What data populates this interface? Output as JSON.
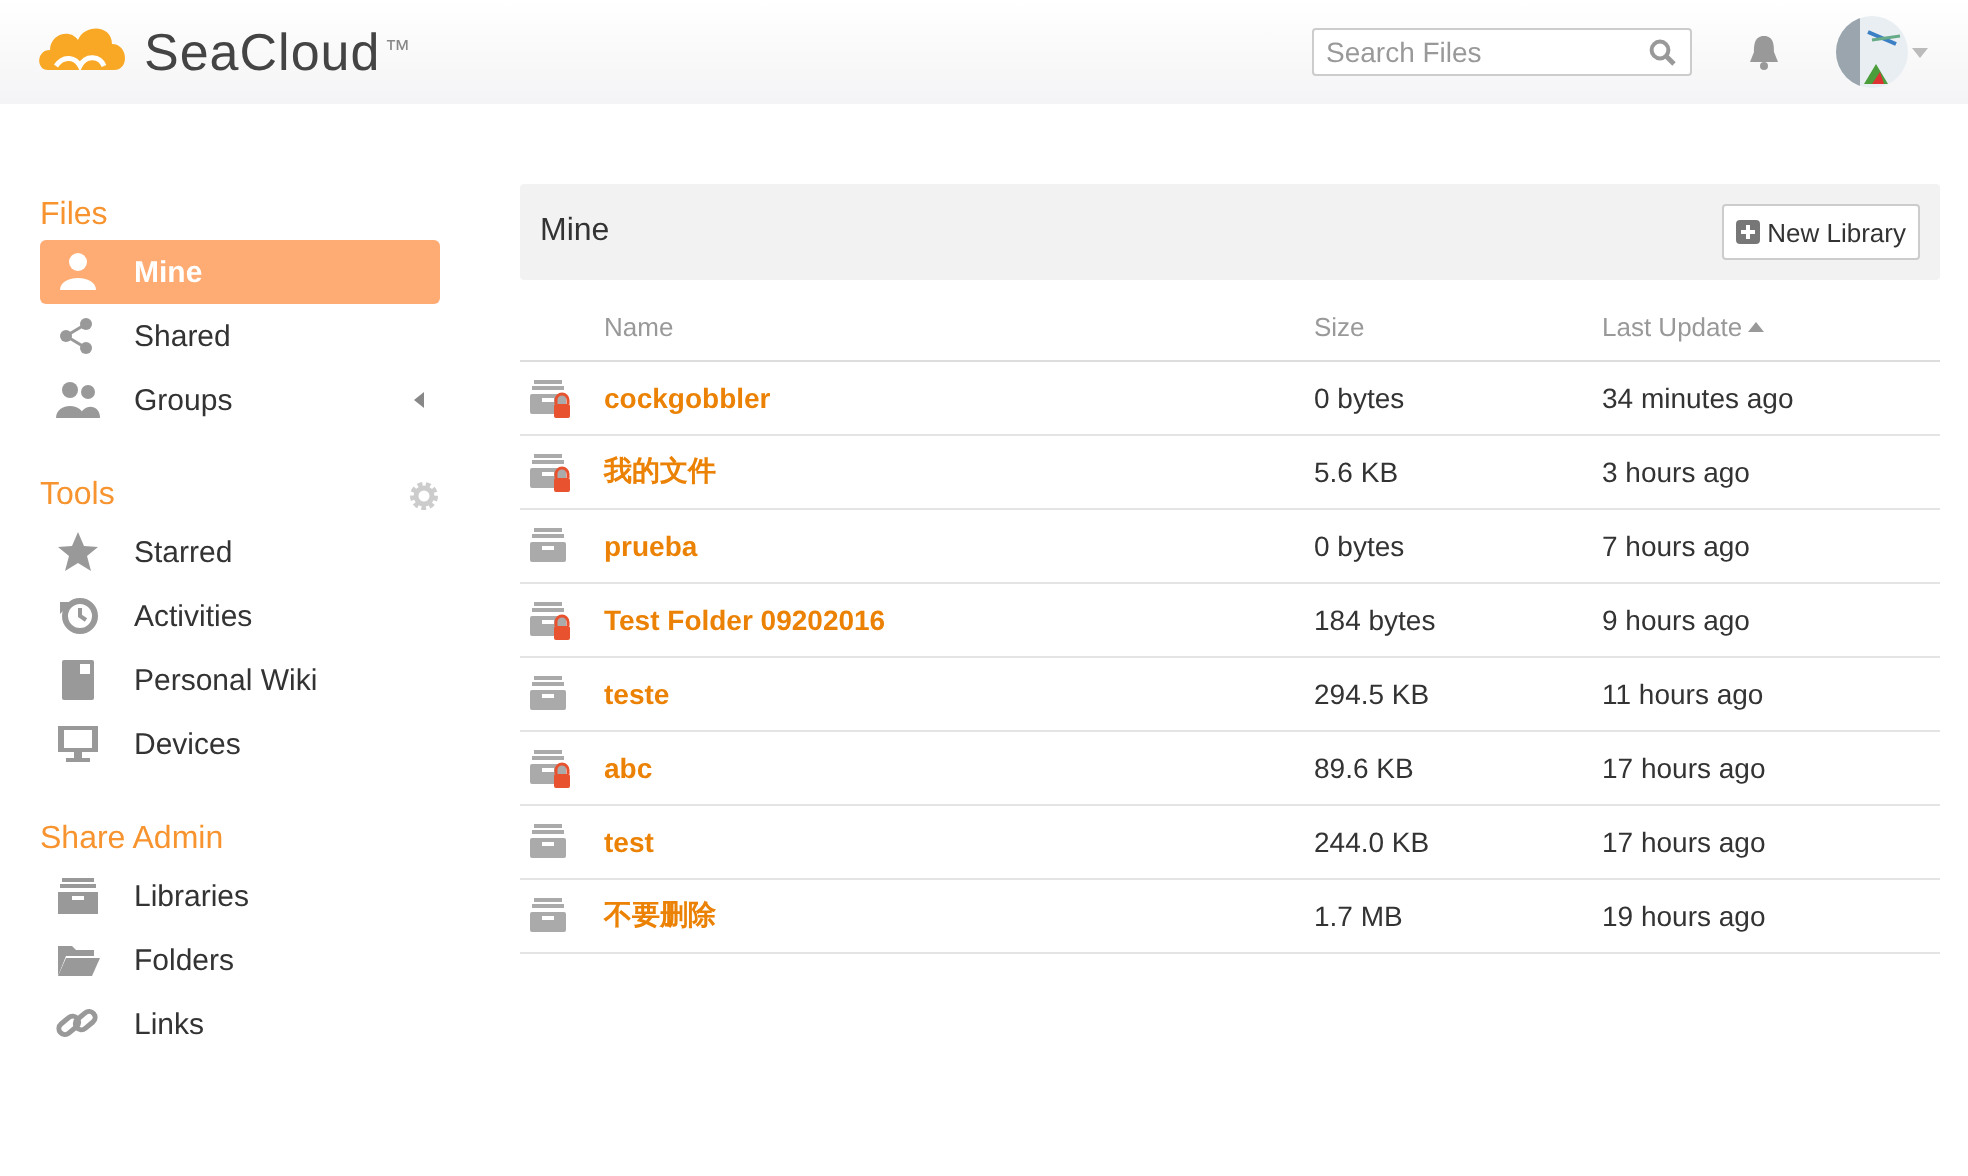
{
  "header": {
    "logo": "SeaCloud",
    "trademark": "™",
    "search": {
      "placeholder": "Search Files"
    }
  },
  "sidebar": [
    {
      "heading": "Files",
      "items": [
        {
          "label": "Mine",
          "selected": true
        },
        {
          "label": "Shared",
          "selected": false
        },
        {
          "label": "Groups",
          "selected": false,
          "expanded": false
        }
      ]
    },
    {
      "heading": "Tools",
      "settings": true,
      "items": [
        {
          "label": "Starred",
          "selected": false
        },
        {
          "label": "Activities",
          "selected": false
        },
        {
          "label": "Personal Wiki",
          "selected": false
        },
        {
          "label": "Devices",
          "selected": false
        }
      ]
    },
    {
      "heading": "Share Admin",
      "items": [
        {
          "label": "Libraries",
          "selected": false
        },
        {
          "label": "Folders",
          "selected": false
        },
        {
          "label": "Links",
          "selected": false
        }
      ]
    }
  ],
  "main": {
    "title": "Mine",
    "new_button": "New Library",
    "columns": [
      {
        "label": "Name",
        "sorted": false
      },
      {
        "label": "Size",
        "sorted": false
      },
      {
        "label": "Last Update",
        "sorted": true
      }
    ],
    "rows": [
      {
        "name": "cockgobbler",
        "size": "0 bytes",
        "updated": "34 minutes ago",
        "encrypted": true
      },
      {
        "name": "我的文件",
        "size": "5.6 KB",
        "updated": "3 hours ago",
        "encrypted": true
      },
      {
        "name": "prueba",
        "size": "0 bytes",
        "updated": "7 hours ago",
        "encrypted": false
      },
      {
        "name": "Test Folder 09202016",
        "size": "184 bytes",
        "updated": "9 hours ago",
        "encrypted": true
      },
      {
        "name": "teste",
        "size": "294.5 KB",
        "updated": "11 hours ago",
        "encrypted": false
      },
      {
        "name": "abc",
        "size": "89.6 KB",
        "updated": "17 hours ago",
        "encrypted": true
      },
      {
        "name": "test",
        "size": "244.0 KB",
        "updated": "17 hours ago",
        "encrypted": false
      },
      {
        "name": "不要删除",
        "size": "1.7 MB",
        "updated": "19 hours ago",
        "encrypted": false
      }
    ]
  }
}
